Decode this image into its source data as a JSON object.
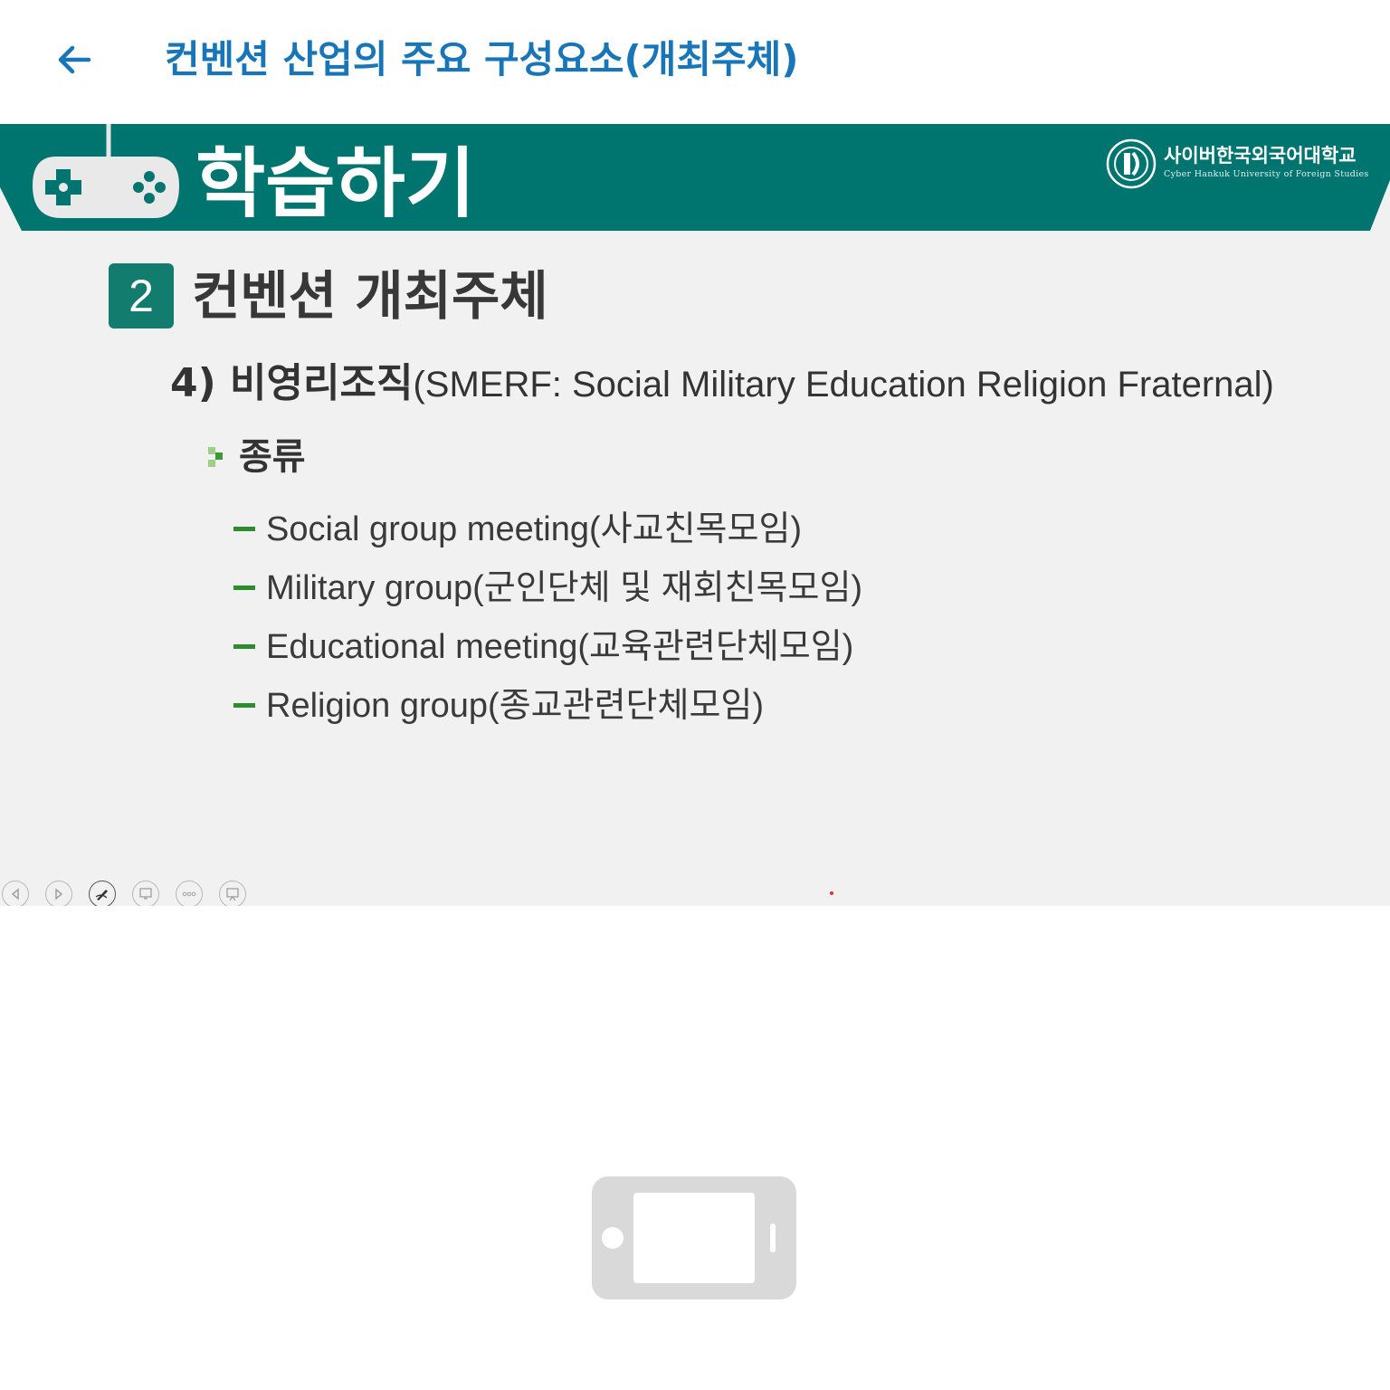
{
  "header": {
    "title": "컨벤션 산업의 주요 구성요소(개최주체)",
    "back_icon": "arrow-left-icon"
  },
  "slide": {
    "banner": {
      "title": "학습하기",
      "university_name": "사이버한국외국어대학교",
      "university_english": "Cyber Hankuk University of Foreign Studies",
      "banner_color": "#00756f"
    },
    "section": {
      "number": "2",
      "title": "컨벤션 개최주체"
    },
    "subheading": {
      "prefix": "4) ",
      "korean": "비영리조직",
      "english": "(SMERF: Social Military Education Religion Fraternal)"
    },
    "bullet": {
      "label": "종류"
    },
    "items": [
      "Social group meeting(사교친목모임)",
      "Military group(군인단체 및 재회친목모임)",
      "Educational meeting(교육관련단체모임)",
      "Religion group(종교관련단체모임)"
    ],
    "controls": [
      "previous-icon",
      "next-icon",
      "pen-icon",
      "pointer-icon",
      "more-icon",
      "slideshow-icon"
    ]
  },
  "placeholder": {
    "icon": "tablet-rotate-icon"
  }
}
